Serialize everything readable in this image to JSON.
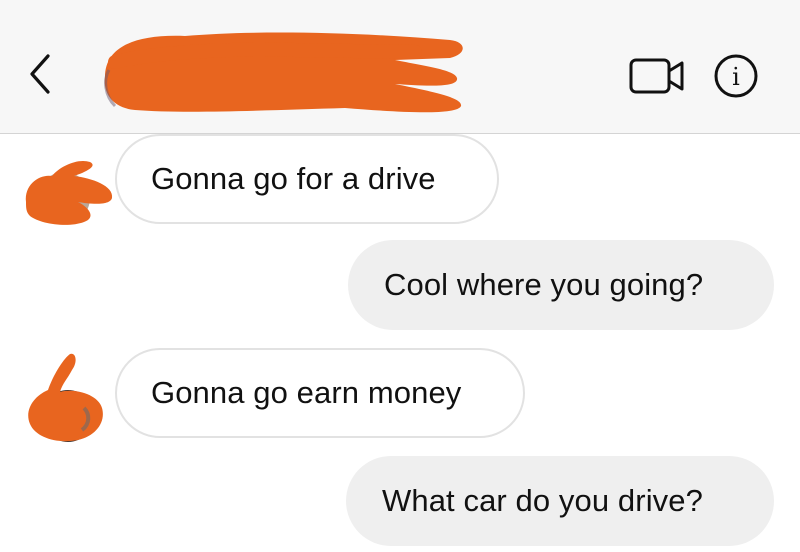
{
  "header": {
    "back_icon": "chevron-left-icon",
    "contact_name_redacted": true,
    "video_icon": "video-camera-icon",
    "info_icon": "info-icon",
    "info_glyph": "i"
  },
  "colors": {
    "redaction": "#e8651f",
    "header_bg": "#f7f7f7",
    "sent_bubble": "#efefef",
    "received_border": "#e2e2e2",
    "text": "#111111"
  },
  "messages": [
    {
      "direction": "received",
      "text": "Gonna go for a drive"
    },
    {
      "direction": "sent",
      "text": "Cool where you going?"
    },
    {
      "direction": "received",
      "text": "Gonna go earn money"
    },
    {
      "direction": "sent",
      "text": "What car do you drive?"
    }
  ]
}
